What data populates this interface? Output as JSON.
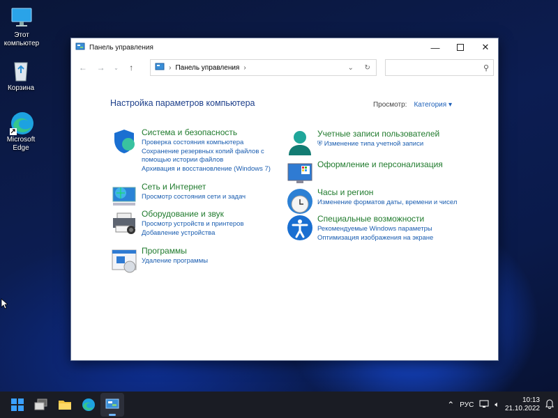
{
  "desktop": {
    "icons": [
      {
        "label": "Этот компьютер",
        "icon": "monitor-icon"
      },
      {
        "label": "Корзина",
        "icon": "recycle-bin-icon"
      },
      {
        "label": "Microsoft Edge",
        "icon": "edge-icon"
      }
    ]
  },
  "window": {
    "title": "Панель управления",
    "breadcrumb": "Панель управления",
    "search_placeholder": "",
    "heading": "Настройка параметров компьютера",
    "view_by_label": "Просмотр:",
    "view_by_value": "Категория",
    "categories": [
      {
        "icon": "security-shield-icon",
        "title": "Система и безопасность",
        "links": [
          "Проверка состояния компьютера",
          "Сохранение резервных копий файлов с помощью истории файлов",
          "Архивация и восстановление (Windows 7)"
        ]
      },
      {
        "icon": "network-globe-icon",
        "title": "Сеть и Интернет",
        "links": [
          "Просмотр состояния сети и задач"
        ]
      },
      {
        "icon": "printer-icon",
        "title": "Оборудование и звук",
        "links": [
          "Просмотр устройств и принтеров",
          "Добавление устройства"
        ]
      },
      {
        "icon": "programs-icon",
        "title": "Программы",
        "links": [
          "Удаление программы"
        ]
      },
      {
        "icon": "user-accounts-icon",
        "title": "Учетные записи пользователей",
        "links": [
          "Изменение типа учетной записи"
        ]
      },
      {
        "icon": "appearance-icon",
        "title": "Оформление и персонализация",
        "links": []
      },
      {
        "icon": "clock-globe-icon",
        "title": "Часы и регион",
        "links": [
          "Изменение форматов даты, времени и чисел"
        ]
      },
      {
        "icon": "accessibility-icon",
        "title": "Специальные возможности",
        "links": [
          "Рекомендуемые Windows параметры",
          "Оптимизация изображения на экране"
        ]
      }
    ]
  },
  "taskbar": {
    "apps": [
      "start-icon",
      "task-view-icon",
      "file-explorer-icon",
      "edge-icon",
      "control-panel-icon"
    ],
    "language": "РУС",
    "time": "10:13",
    "date": "21.10.2022"
  },
  "colors": {
    "category_title": "#1f7a2c",
    "link": "#1a5db0",
    "heading": "#1c3e8a",
    "taskbar": "#1a1c24"
  }
}
